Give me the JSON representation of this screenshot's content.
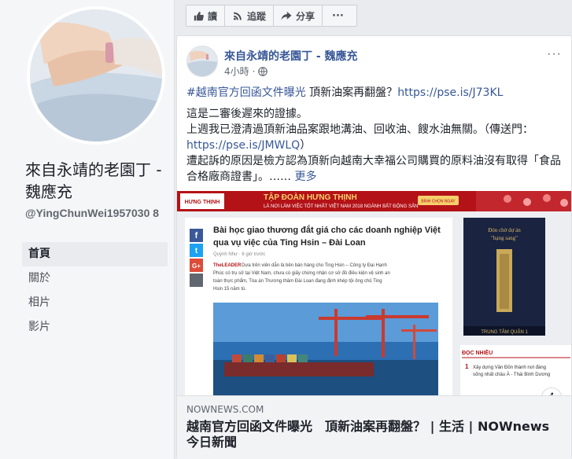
{
  "page": {
    "name": "來自永靖的老園丁 - 魏應充",
    "handle": "@YingChunWei1957030 8"
  },
  "nav": {
    "items": [
      "首頁",
      "關於",
      "相片",
      "影片"
    ]
  },
  "actionbar": {
    "read": "讀",
    "follow": "追蹤",
    "share": "分享",
    "more": "···"
  },
  "post": {
    "author": "來自永靖的老園丁 - 魏應充",
    "time": "4小時",
    "hashtag": "#越南官方回函文件曝光",
    "headline_text": " 頂新油案再翻盤？",
    "headline_link": "https://pse.is/J73KL",
    "line1": "這是二審後遲來的證據。",
    "line2_pre": "上週我已澄清過頂新油品案跟地溝油、回收油、餿水油無關。（傳送門：",
    "line2_link": "https://pse.is/JMWLQ",
    "line2_post": "）",
    "line3": "遭起訴的原因是檢方認為頂新向越南大幸福公司購買的原料油沒有取得「食品合格廠商證書」。……",
    "see_more": "更多"
  },
  "link_card": {
    "banner_brand": "HƯNG THỊNH",
    "banner_title": "TẬP ĐOÀN HƯNG THỊNH",
    "banner_sub": "LÀ NƠI LÀM VIỆC TỐT NHẤT VIỆT NAM 2018 NGÀNH BẤT ĐỘNG SẢN",
    "banner_badge": "BÌNH CHỌN NGAY",
    "article_title": "Bài học giao thương đắt giá cho các doanh nghiệp Việt qua vụ việc của Ting Hsin – Đài Loan",
    "article_author": "Quỳnh Như",
    "article_time": "6 giờ trước",
    "article_brand": "TheLEADER",
    "article_lead": "Dựa trên viên dẫn là bên bán hàng cho Ting Hsin – Công ty Đại Hạnh Phúc có trụ sở tại Việt Nam, chưa có giấy chứng nhận cơ sở đủ điều kiện vệ sinh an toàn thực phẩm, Tòa án Thương thâm Đài Loan đang định khép tội ông chủ Ting Hsin 15 năm tù.",
    "ad_line1": "Đón chờ dự án",
    "ad_line2": "\"hạng sang\"",
    "ad_footer": "TRUNG TÂM QUẬN 1",
    "side_heading": "ĐỌC NHIỀU",
    "side_item": "Xây dựng Vân Đồn thành nơi đáng sống nhất châu Á - Thái Bình Dương",
    "side_num": "1",
    "domain": "NOWNEWS.COM",
    "title": "越南官方回函文件曝光　頂新油案再翻盤？ | 生活 | NOWnews 今日新聞"
  },
  "colors": {
    "link": "#385898",
    "sidebar_bg": "#f5f6f7",
    "page_bg": "#e9ebee",
    "banner_red": "#b31217"
  }
}
